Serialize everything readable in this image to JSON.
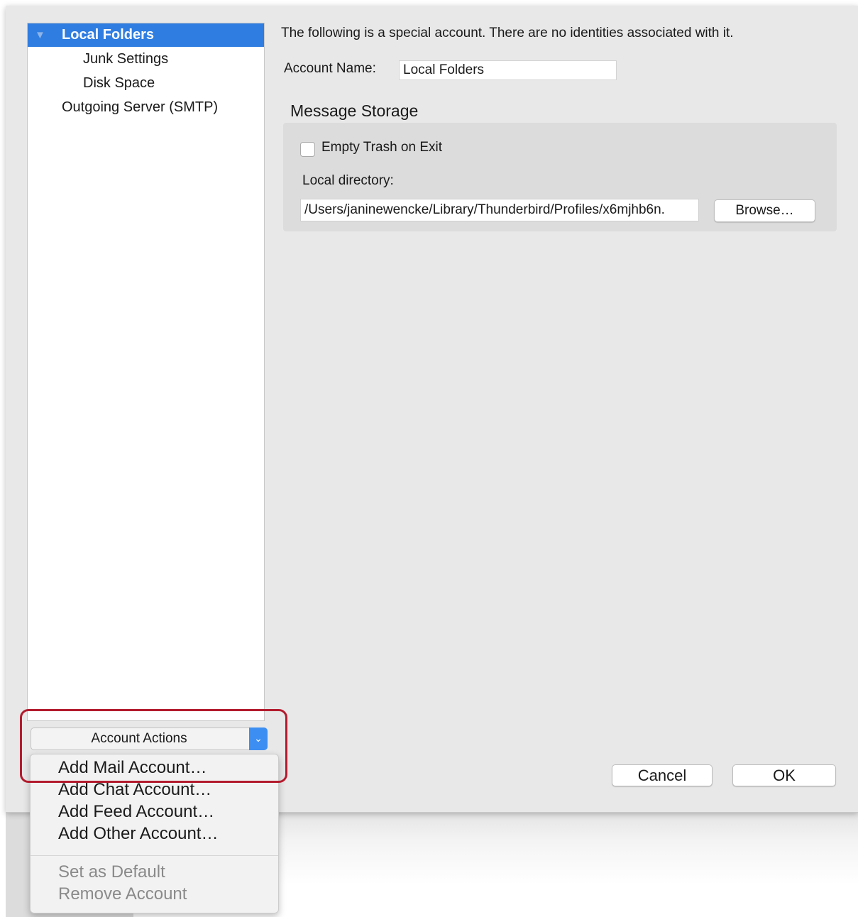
{
  "sidebar": {
    "items": [
      {
        "label": "Local Folders",
        "selected": true,
        "expanded": true
      },
      {
        "label": "Junk Settings"
      },
      {
        "label": "Disk Space"
      },
      {
        "label": "Outgoing Server (SMTP)"
      }
    ],
    "expand_icon": "triangle-down-icon"
  },
  "main": {
    "intro": "The following is a special account. There are no identities associated with it.",
    "account_name_label": "Account Name:",
    "account_name_value": "Local Folders",
    "message_storage": {
      "title": "Message Storage",
      "empty_trash_label": "Empty Trash on Exit",
      "empty_trash_checked": false,
      "local_directory_label": "Local directory:",
      "local_directory_value": "/Users/janinewencke/Library/Thunderbird/Profiles/x6mjhb6n.",
      "browse_label": "Browse…"
    }
  },
  "account_actions": {
    "label": "Account Actions",
    "chevron_icon": "chevron-down-icon",
    "menu": [
      {
        "label": "Add Mail Account…",
        "enabled": true
      },
      {
        "label": "Add Chat Account…",
        "enabled": true
      },
      {
        "label": "Add Feed Account…",
        "enabled": true
      },
      {
        "label": "Add Other Account…",
        "enabled": true
      },
      {
        "label": "Set as Default",
        "enabled": false
      },
      {
        "label": "Remove Account",
        "enabled": false
      }
    ]
  },
  "footer": {
    "cancel_label": "Cancel",
    "ok_label": "OK"
  },
  "colors": {
    "selection": "#2f7de1",
    "highlight_annotation": "#b31b2d",
    "window_bg": "#e8e8e8"
  }
}
